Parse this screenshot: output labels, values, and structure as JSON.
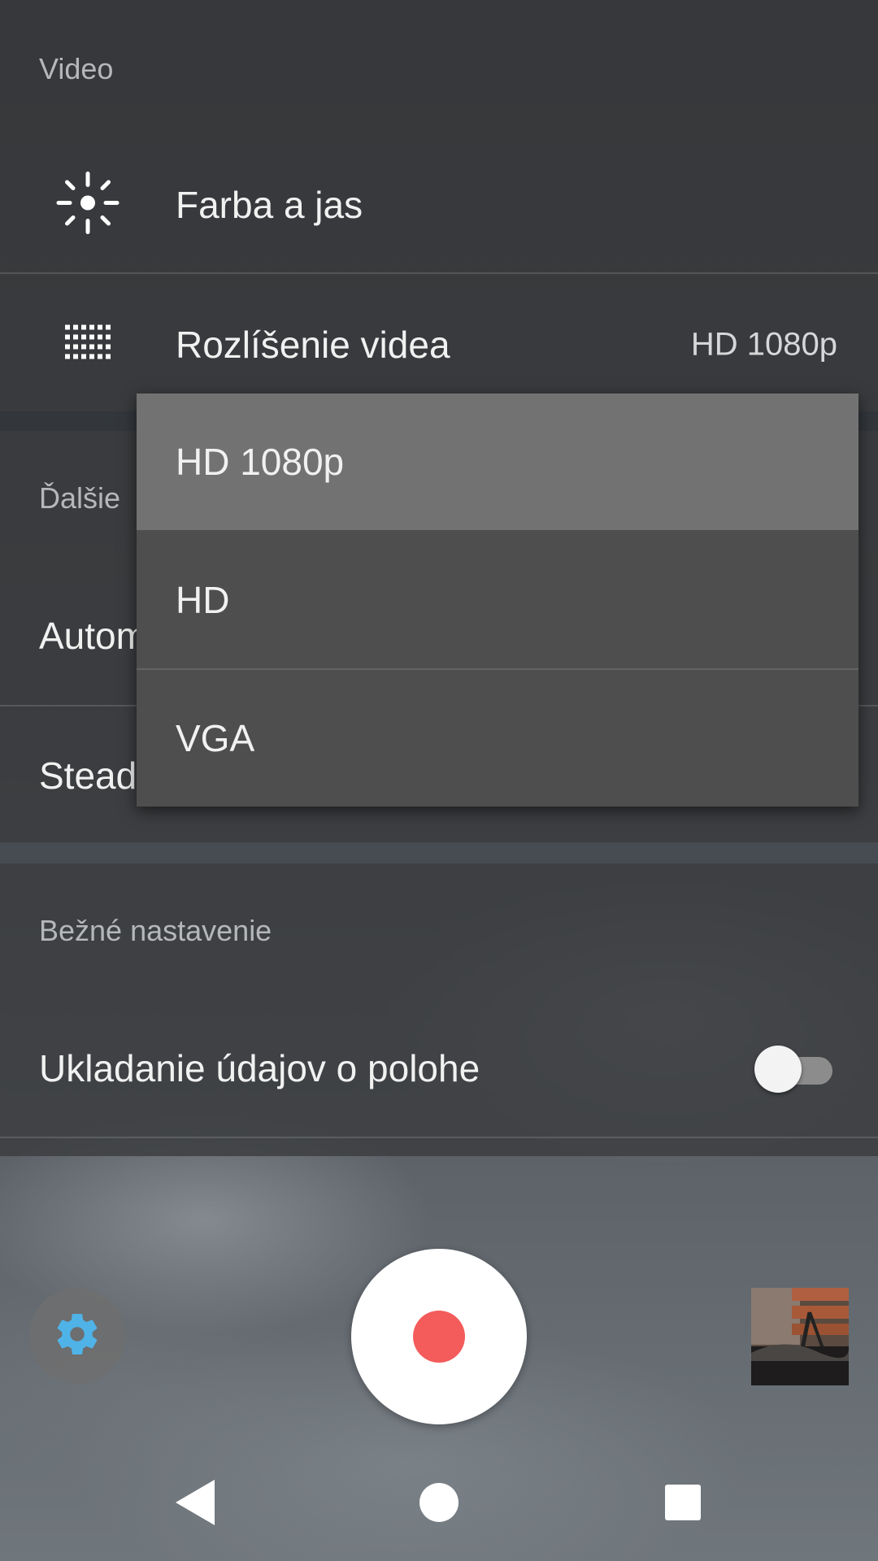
{
  "sections": {
    "video": {
      "title": "Video",
      "items": [
        {
          "label": "Farba a jas",
          "icon": "brightness-icon"
        },
        {
          "label": "Rozlíšenie videa",
          "value": "HD 1080p",
          "icon": "grid-resolution-icon"
        }
      ]
    },
    "more": {
      "title": "Ďalšie",
      "items": [
        {
          "label": "Autom"
        },
        {
          "label": "Stead"
        }
      ]
    },
    "general": {
      "title": "Bežné nastavenie",
      "items": [
        {
          "label": "Ukladanie údajov o polohe",
          "toggle": false
        }
      ]
    }
  },
  "dropdown": {
    "options": [
      "HD 1080p",
      "HD",
      "VGA"
    ],
    "selected": "HD 1080p"
  },
  "controls": {
    "settings_icon": "gear-icon",
    "record_icon": "record-icon",
    "accent_color": "#4FB3E8",
    "record_color": "#F45B5B"
  },
  "navbar": [
    "back-icon",
    "home-icon",
    "recents-icon"
  ]
}
